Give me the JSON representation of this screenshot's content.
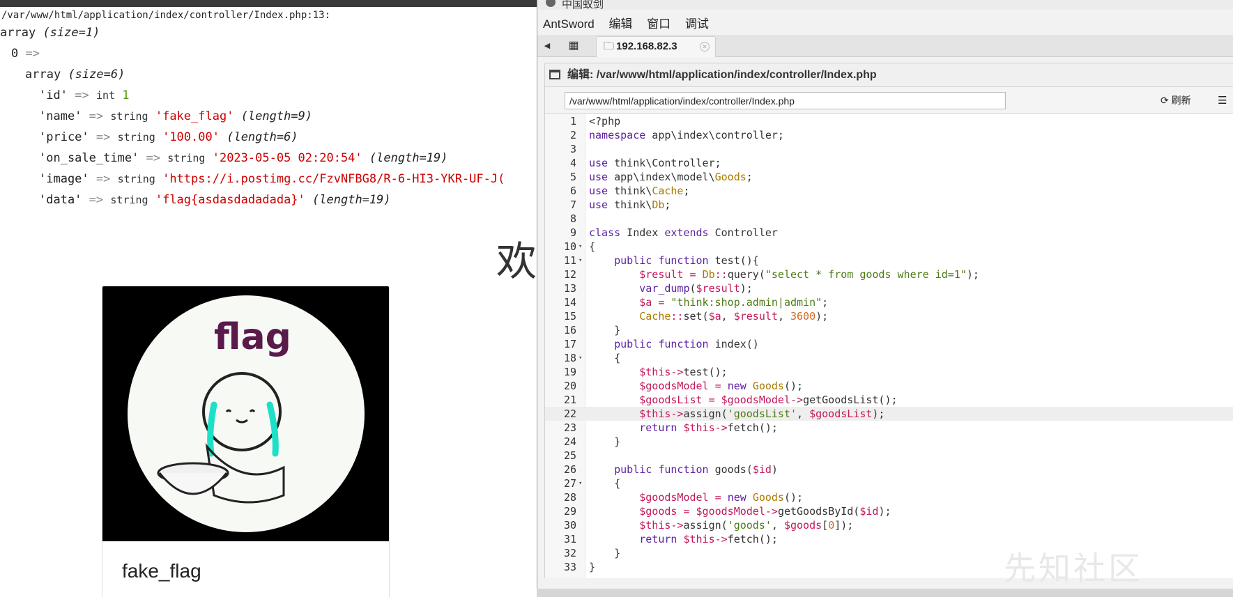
{
  "dump": {
    "path": "/var/www/html/application/index/controller/Index.php:13:",
    "array_kw": "array",
    "size1": "(size=1)",
    "key0": "0",
    "arrow": "=>",
    "size6": "(size=6)",
    "rows": [
      {
        "key": "'id'",
        "type": "int",
        "value": "1",
        "len": ""
      },
      {
        "key": "'name'",
        "type": "string",
        "value": "'fake_flag'",
        "len": "(length=9)"
      },
      {
        "key": "'price'",
        "type": "string",
        "value": "'100.00'",
        "len": "(length=6)"
      },
      {
        "key": "'on_sale_time'",
        "type": "string",
        "value": "'2023-05-05 02:20:54'",
        "len": "(length=19)"
      },
      {
        "key": "'image'",
        "type": "string",
        "value": "'https://i.postimg.cc/FzvNFBG8/R-6-HI3-YKR-UF-J(",
        "len": ""
      },
      {
        "key": "'data'",
        "type": "string",
        "value": "'flag{asdasdadadada}'",
        "len": "(length=19)"
      }
    ]
  },
  "page": {
    "welcome": "欢",
    "card_image_caption": "flag",
    "card_title": "fake_flag"
  },
  "antsword": {
    "window_title": "中国蚁剑",
    "menu": [
      "AntSword",
      "编辑",
      "窗口",
      "调试"
    ],
    "tab_host": "192.168.82.3",
    "panel_title": "编辑: /var/www/html/application/index/controller/Index.php",
    "path_value": "/var/www/html/application/index/controller/Index.php",
    "refresh_label": "刷新",
    "active_line": 22,
    "code_lines": [
      "<?php",
      "namespace app\\index\\controller;",
      "",
      "use think\\Controller;",
      "use app\\index\\model\\Goods;",
      "use think\\Cache;",
      "use think\\Db;",
      "",
      "class Index extends Controller",
      "{",
      "    public function test(){",
      "        $result = Db::query(\"select * from goods where id=1\");",
      "        var_dump($result);",
      "        $a = \"think:shop.admin|admin\";",
      "        Cache::set($a, $result, 3600);",
      "    }",
      "    public function index()",
      "    {",
      "        $this->test();",
      "        $goodsModel = new Goods();",
      "        $goodsList = $goodsModel->getGoodsList();",
      "        $this->assign('goodsList', $goodsList);",
      "        return $this->fetch();",
      "    }",
      "",
      "    public function goods($id)",
      "    {",
      "        $goodsModel = new Goods();",
      "        $goods = $goodsModel->getGoodsById($id);",
      "        $this->assign('goods', $goods[0]);",
      "        return $this->fetch();",
      "    }",
      "}"
    ],
    "fold_lines": [
      10,
      11,
      18,
      27
    ]
  },
  "watermark": "先知社区",
  "colors": {
    "keyword": "#5b1fa3",
    "variable": "#c2185b",
    "string": "#4e7a15",
    "number": "#d2691e",
    "class": "#aa7a00",
    "dump_string": "#cc0000",
    "dump_int": "#4e9a06"
  }
}
